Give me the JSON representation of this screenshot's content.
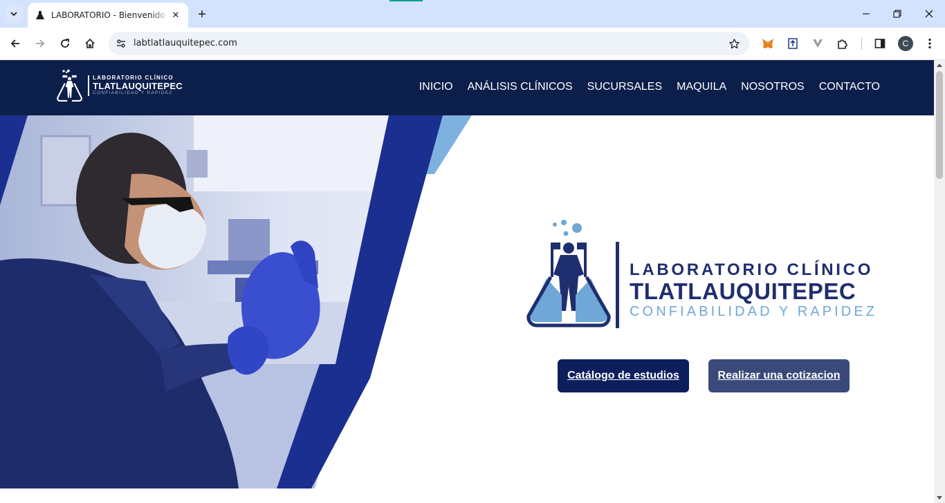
{
  "browser": {
    "tab_title": "LABORATORIO - Bienvenido a NUESTRO LABORATORIO",
    "url": "labtlatlauquitepec.com",
    "profile_initial": "C"
  },
  "site": {
    "logo": {
      "line1": "LABORATORIO CLÍNICO",
      "line2": "TLATLAUQUITEPEC",
      "line3": "CONFIABILIDAD Y RAPIDEZ"
    },
    "nav": [
      "INICIO",
      "ANÁLISIS CLÍNICOS",
      "SUCURSALES",
      "MAQUILA",
      "NOSOTROS",
      "CONTACTO"
    ]
  },
  "hero": {
    "logo": {
      "line1": "LABORATORIO CLÍNICO",
      "line2": "TLATLAUQUITEPEC",
      "line3": "CONFIABILIDAD Y RAPIDEZ"
    },
    "buttons": {
      "catalog": "Catálogo de estudios",
      "quote": "Realizar una cotizacion"
    }
  },
  "colors": {
    "header_bg": "#0c1f4a",
    "brand_dark": "#1f2e6e",
    "brand_light": "#6fa7d6",
    "button_primary": "#0c1f5c",
    "button_secondary": "#394a7a"
  },
  "icons": {
    "tab_search": "chevron-down-icon",
    "favicon": "lab-flask-icon",
    "extensions": [
      "metamask-fox-icon",
      "upload-extension-icon",
      "vee-extension-icon",
      "puzzle-piece-icon"
    ]
  }
}
